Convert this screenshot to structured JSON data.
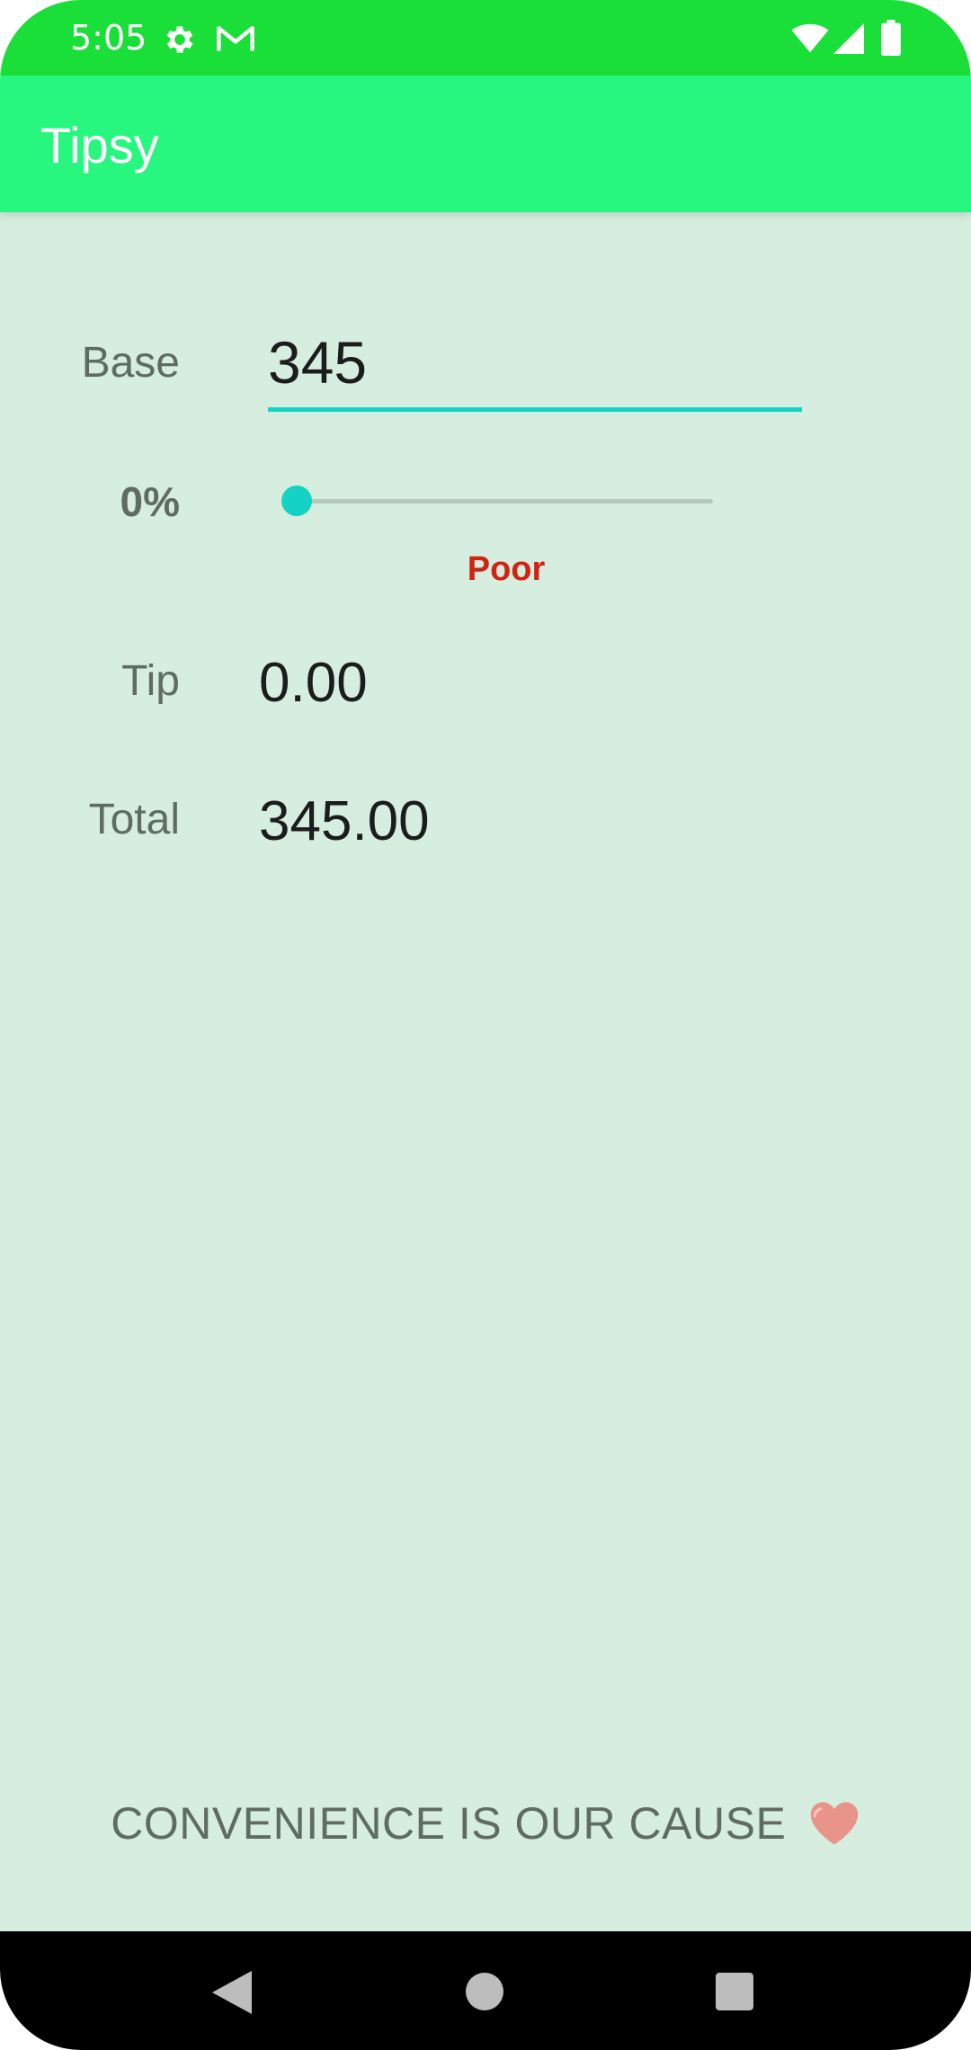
{
  "status_bar": {
    "time": "5:05",
    "icons": [
      "gear-icon",
      "mail-icon",
      "wifi-icon",
      "signal-icon",
      "battery-icon"
    ]
  },
  "app_bar": {
    "title": "Tipsy"
  },
  "form": {
    "base_label": "Base",
    "base_value": "345",
    "percent_label": "0%",
    "slider_value_percent": 0,
    "rating_label": "Poor",
    "tip_label": "Tip",
    "tip_value": "0.00",
    "total_label": "Total",
    "total_value": "345.00"
  },
  "footer": {
    "text": "CONVENIENCE IS OUR CAUSE",
    "icon": "heart-icon"
  },
  "nav_bar": {
    "icons": [
      "back-icon",
      "home-icon",
      "recents-icon"
    ]
  },
  "colors": {
    "status_bar": "#1adf38",
    "app_bar": "#27f67f",
    "background": "#d6eedf",
    "accent": "#14d3c4",
    "rating": "#d02413"
  }
}
